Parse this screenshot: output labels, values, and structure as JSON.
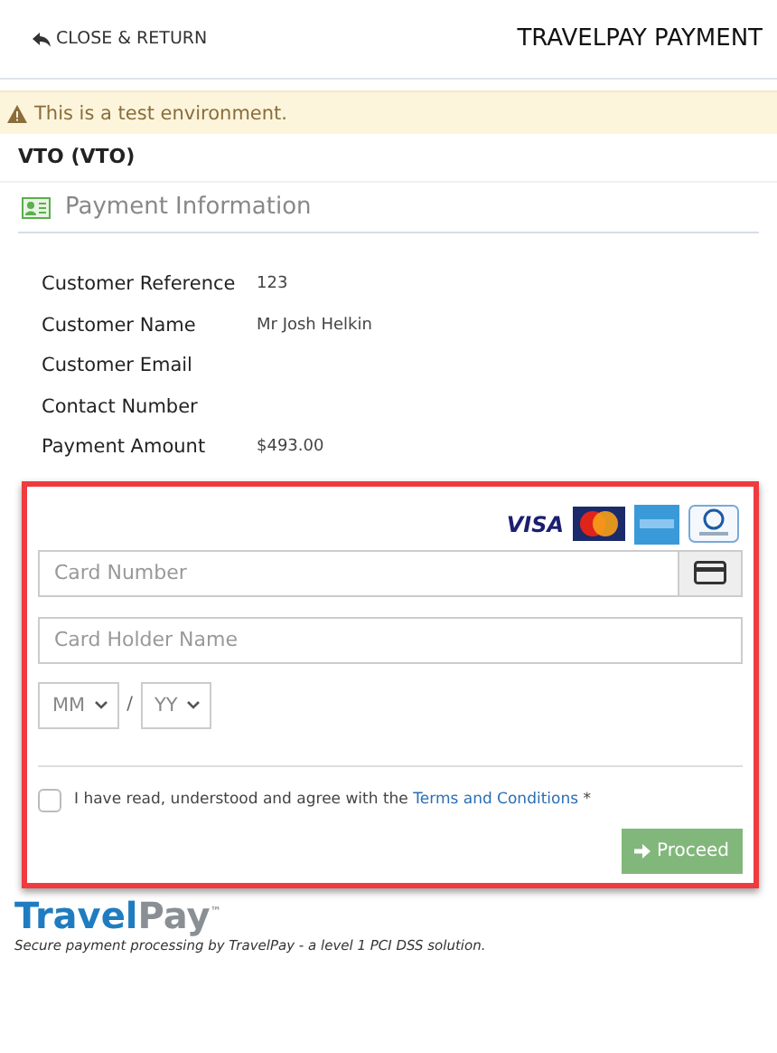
{
  "header": {
    "back_link": "CLOSE & RETURN",
    "title": "TRAVELPAY PAYMENT"
  },
  "alert": {
    "text": "This is a test environment."
  },
  "agency": "VTO (VTO)",
  "section_title": "Payment Information",
  "details": [
    {
      "label": "Customer Reference",
      "value": "123"
    },
    {
      "label": "Customer Name",
      "value": "Mr Josh Helkin"
    },
    {
      "label": "Customer Email"
    },
    {
      "label": "Contact Number"
    },
    {
      "label": "Payment Amount",
      "value": "$493.00"
    }
  ],
  "card_form": {
    "brands": [
      {
        "kind": "visa",
        "text": "VISA"
      },
      {
        "kind": "mastercard"
      },
      {
        "kind": "amex"
      },
      {
        "kind": "diners"
      }
    ],
    "card_number": {
      "placeholder": "Card Number"
    },
    "holder_name": {
      "placeholder": "Card Holder Name"
    },
    "expiry": {
      "month": "MM",
      "separator": "/",
      "year": "YY"
    },
    "terms": {
      "checked": false,
      "text": "I have read, understood and agree with the",
      "link": "Terms and Conditions",
      "required_mark": "*"
    },
    "proceed_button": "Proceed"
  },
  "footer": {
    "logo": {
      "first": "Travel",
      "second": "Pay",
      "mark": "™"
    },
    "tagline": "Secure payment processing by TravelPay - a level 1 PCI DSS solution."
  }
}
